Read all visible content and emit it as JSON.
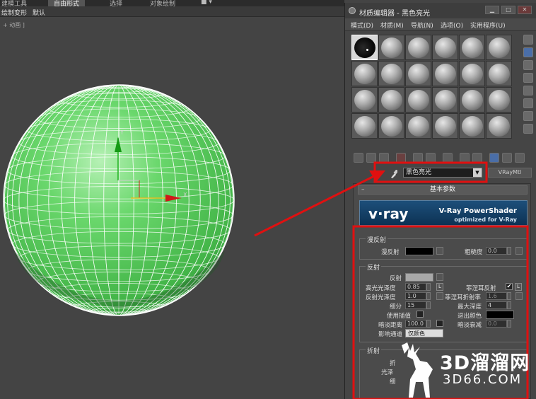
{
  "ribbon": {
    "tabs": [
      "建模工具",
      "自由形式",
      "选择",
      "对象绘制"
    ]
  },
  "subbar": {
    "items": [
      "绘制变形",
      "默认"
    ]
  },
  "viewport": {
    "label": "+ 动画 ]",
    "axis_labels": {
      "x": "X",
      "y": "Y"
    },
    "sphere_color": "#55c85a"
  },
  "material_editor": {
    "title": "材质编辑器 - 黑色亮光",
    "menu": [
      "模式(D)",
      "材质(M)",
      "导航(N)",
      "选项(O)",
      "实用程序(U)"
    ],
    "material_name": "黑色亮光",
    "material_type": "VRayMtl",
    "rollout_title": "基本参数",
    "banner": {
      "logo": "v·ray",
      "title": "V-Ray PowerShader",
      "subtitle": "optimized for V-Ray"
    },
    "diffuse": {
      "group_title": "漫反射",
      "diffuse_label": "漫反射",
      "roughness_label": "粗糙度",
      "roughness_value": "0.0",
      "diffuse_color": "#000000"
    },
    "reflection": {
      "group_title": "反射",
      "reflect_label": "反射",
      "reflect_color": "#a8a8a8",
      "hilight_gloss_label": "高光光泽度",
      "hilight_gloss_value": "0.85",
      "l_label": "L",
      "fresnel_label": "菲涅耳反射",
      "refl_gloss_label": "反射光泽度",
      "refl_gloss_value": "1.0",
      "fresnel_ior_label": "菲涅耳折射率",
      "fresnel_ior_value": "1.6",
      "subdivs_label": "细分",
      "subdivs_value": "15",
      "max_depth_label": "最大深度",
      "max_depth_value": "4",
      "use_interp_label": "使用插值",
      "exit_color_label": "退出颜色",
      "exit_color": "#000000",
      "dim_dist_label": "暗淡距离",
      "dim_dist_value": "100.0",
      "dim_falloff_label": "暗淡衰减",
      "dim_falloff_value": "0.0",
      "affect_channels_label": "影响通道",
      "affect_channels_value": "仅颜色"
    },
    "refraction": {
      "group_title": "折射",
      "partial_labels": [
        "折",
        "光泽",
        "细"
      ]
    }
  },
  "watermark": {
    "text1": "3D溜溜网",
    "text2": "3D66.COM"
  },
  "colors": {
    "annotation_red": "#e01010",
    "vray_blue": "#1d4f7a"
  }
}
